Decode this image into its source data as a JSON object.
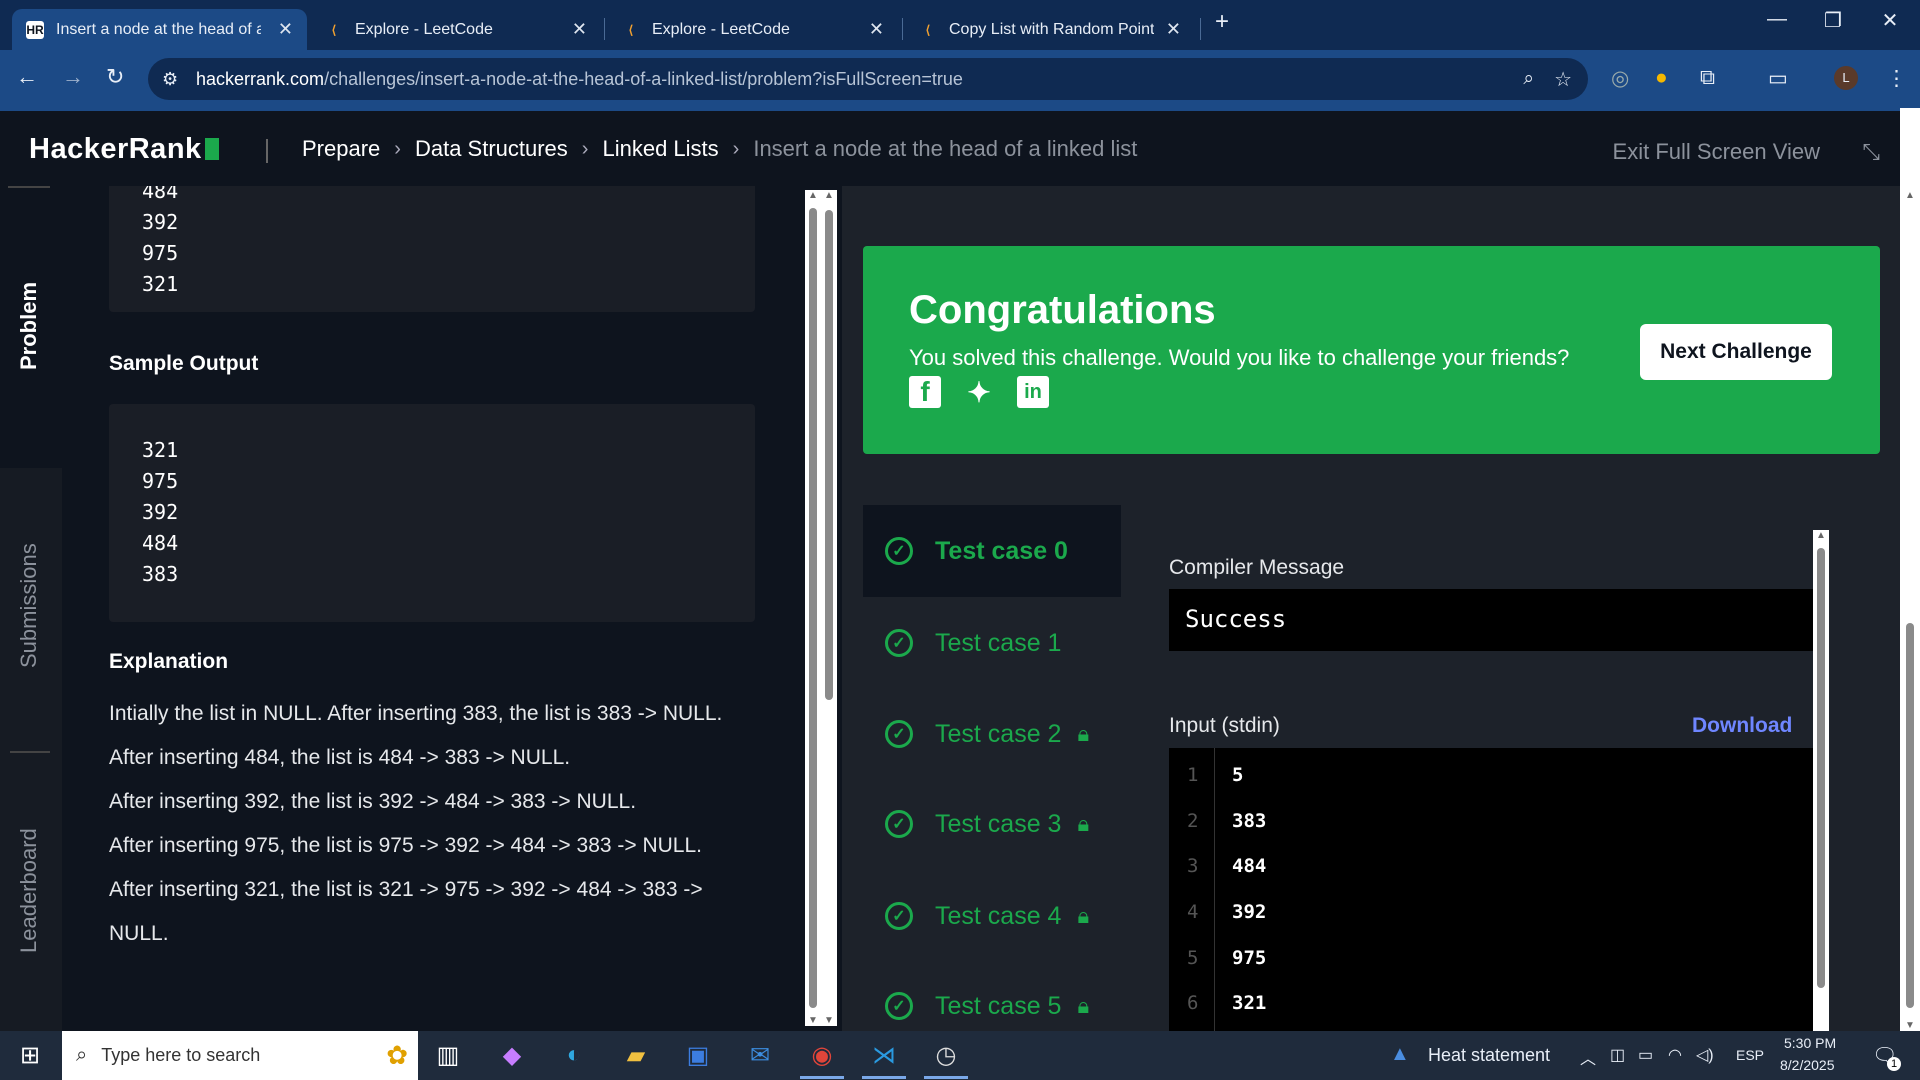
{
  "tabs": [
    {
      "title": "Insert a node at the head of a li",
      "favicon": "HR"
    },
    {
      "title": "Explore - LeetCode",
      "favicon": "leetcode-icon"
    },
    {
      "title": "Explore - LeetCode",
      "favicon": "leetcode-icon"
    },
    {
      "title": "Copy List with Random Pointer",
      "favicon": "leetcode-icon"
    }
  ],
  "address": {
    "domain": "hackerrank.com",
    "path": "/challenges/insert-a-node-at-the-head-of-a-linked-list/problem?isFullScreen=true"
  },
  "header": {
    "logo": "HackerRank",
    "crumbs": [
      "Prepare",
      "Data Structures",
      "Linked Lists"
    ],
    "current": "Insert a node at the head of a linked list",
    "exit_label": "Exit Full Screen View"
  },
  "sidenav": {
    "problem": "Problem",
    "submissions": "Submissions",
    "leaderboard": "Leaderboard"
  },
  "problem": {
    "input_tail": [
      "484",
      "392",
      "975",
      "321"
    ],
    "sample_output_title": "Sample Output",
    "sample_output": [
      "321",
      "975",
      "392",
      "484",
      "383"
    ],
    "explanation_title": "Explanation",
    "explanation": [
      "Intially the list in NULL. After inserting 383, the list is 383 -> NULL.",
      "After inserting 484, the list is 484 -> 383 -> NULL.",
      "After inserting 392, the list is 392 -> 484 -> 383 -> NULL.",
      "After inserting 975, the list is 975 -> 392 -> 484 -> 383 -> NULL.",
      "After inserting 321, the list is 321 -> 975 -> 392 -> 484 -> 383 ->",
      "NULL."
    ]
  },
  "result": {
    "title": "Congratulations",
    "subtitle": "You solved this challenge. Would you like to challenge your friends?",
    "next_label": "Next Challenge",
    "test_cases": [
      "Test case 0",
      "Test case 1",
      "Test case 2",
      "Test case 3",
      "Test case 4",
      "Test case 5"
    ],
    "compiler_label": "Compiler Message",
    "compiler_message": "Success",
    "input_label": "Input (stdin)",
    "download_label": "Download",
    "stdin_lines": [
      {
        "n": "1",
        "v": "5"
      },
      {
        "n": "2",
        "v": "383"
      },
      {
        "n": "3",
        "v": "484"
      },
      {
        "n": "4",
        "v": "392"
      },
      {
        "n": "5",
        "v": "975"
      },
      {
        "n": "6",
        "v": "321"
      }
    ]
  },
  "taskbar": {
    "search_placeholder": "Type here to search",
    "weather": "Heat statement",
    "lang": "ESP",
    "time": "5:30 PM",
    "date": "8/2/2025",
    "notif_count": "1"
  },
  "colors": {
    "accent": "#1ba94c",
    "chrome": "#1c4a86",
    "bg": "#0e141e",
    "link": "#6f86ff"
  }
}
